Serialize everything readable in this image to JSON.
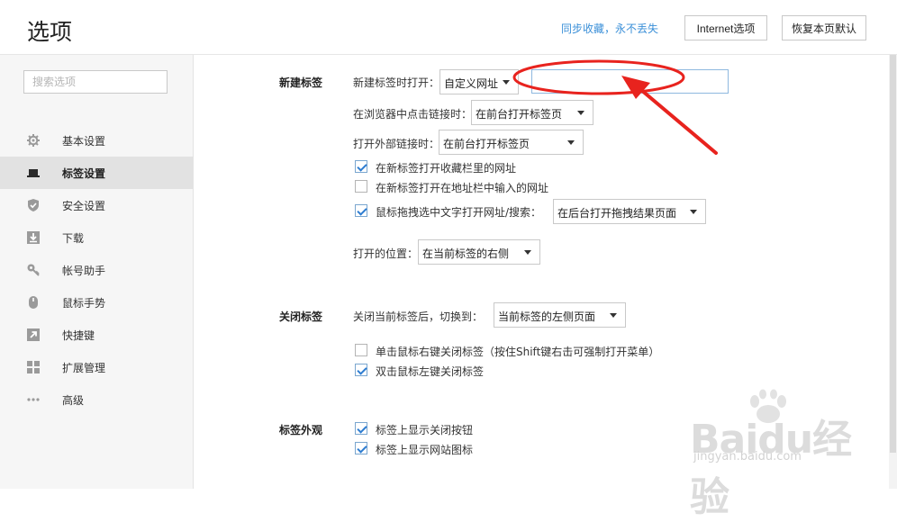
{
  "header": {
    "title": "选项",
    "sync_link": "同步收藏，永不丢失",
    "internet_options_label": "Internet选项",
    "restore_defaults_label": "恢复本页默认"
  },
  "sidebar": {
    "search_placeholder": "搜索选项",
    "items": [
      {
        "label": "基本设置",
        "icon": "gear-icon"
      },
      {
        "label": "标签设置",
        "icon": "tab-icon",
        "active": true
      },
      {
        "label": "安全设置",
        "icon": "shield-icon"
      },
      {
        "label": "下载",
        "icon": "download-icon"
      },
      {
        "label": "帐号助手",
        "icon": "key-icon"
      },
      {
        "label": "鼠标手势",
        "icon": "mouse-icon"
      },
      {
        "label": "快捷键",
        "icon": "shortcut-icon"
      },
      {
        "label": "扩展管理",
        "icon": "extensions-icon"
      },
      {
        "label": "高级",
        "icon": "more-icon"
      }
    ]
  },
  "new_tab": {
    "section_title": "新建标签",
    "open_label": "新建标签时打开：",
    "open_value": "自定义网址",
    "custom_url_value": "",
    "click_link_label": "在浏览器中点击链接时：",
    "click_link_value": "在前台打开标签页",
    "external_link_label": "打开外部链接时：",
    "external_link_value": "在前台打开标签页",
    "cb_favorites": {
      "label": "在新标签打开收藏栏里的网址",
      "checked": true
    },
    "cb_address": {
      "label": "在新标签打开在地址栏中输入的网址",
      "checked": false
    },
    "cb_drag": {
      "label": "鼠标拖拽选中文字打开网址/搜索：",
      "checked": true
    },
    "drag_value": "在后台打开拖拽结果页面",
    "position_label": "打开的位置：",
    "position_value": "在当前标签的右侧"
  },
  "close_tab": {
    "section_title": "关闭标签",
    "after_close_label": "关闭当前标签后，切换到：",
    "after_close_value": "当前标签的左侧页面",
    "cb_right_click": {
      "label": "单击鼠标右键关闭标签（按住Shift键右击可强制打开菜单）",
      "checked": false
    },
    "cb_double_click": {
      "label": "双击鼠标左键关闭标签",
      "checked": true
    }
  },
  "tab_appearance": {
    "section_title": "标签外观",
    "cb_close_button": {
      "label": "标签上显示关闭按钮",
      "checked": true
    },
    "cb_site_icon": {
      "label": "标签上显示网站图标",
      "checked": true
    }
  },
  "watermark": {
    "brand": "Baidu经验",
    "url": "jingyan.baidu.com"
  },
  "colors": {
    "link": "#3a8fd8",
    "annotation_red": "#e8231e",
    "checkbox_check": "#2e7dd1"
  }
}
